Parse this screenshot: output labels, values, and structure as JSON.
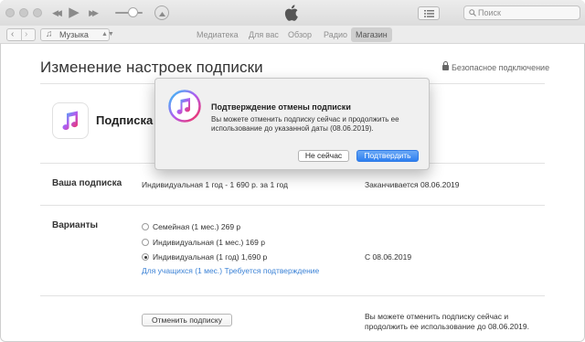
{
  "toolbar": {
    "search_placeholder": "Поиск",
    "rewind_glyph": "◀◀",
    "play_glyph": "▶",
    "forward_glyph": "▶▶"
  },
  "navbar": {
    "back_glyph": "‹",
    "forward_glyph": "›",
    "library_select": "Музыка",
    "library_icon_glyph": "♫",
    "tabs": [
      {
        "label": "Медиатека",
        "active": false
      },
      {
        "label": "Для вас",
        "active": false
      },
      {
        "label": "Обзор",
        "active": false
      },
      {
        "label": "Радио",
        "active": false
      },
      {
        "label": "Магазин",
        "active": true
      }
    ]
  },
  "page": {
    "heading": "Изменение настроек подписки",
    "secure_label": "Безопасное подключение",
    "subscription_title": "Подписка на Apple Music",
    "your_subscription_label": "Ваша подписка",
    "your_subscription_value": "Индивидуальная 1 год - 1 690 р. за 1 год",
    "expires_text": "Заканчивается 08.06.2019",
    "options_label": "Варианты",
    "options": [
      {
        "label": "Семейная (1 мес.) 269 р",
        "selected": false
      },
      {
        "label": "Индивидуальная (1 мес.) 169 р",
        "selected": false
      },
      {
        "label": "Индивидуальная (1 год) 1,690 р",
        "selected": true
      }
    ],
    "option_start": "С 08.06.2019",
    "student_link": "Для учащихся (1 мес.) Требуется подтверждение",
    "cancel_button": "Отменить подписку",
    "cancel_note": "Вы можете отменить подписку сейчас и продолжить ее использование до 08.06.2019."
  },
  "dialog": {
    "title": "Подтверждение отмены подписки",
    "message": "Вы можете отменить подписку сейчас и продолжить ее использование до указанной даты (08.06.2019).",
    "cancel_label": "Не сейчас",
    "confirm_label": "Подтвердить"
  },
  "icons": {
    "music_note": "music-note-icon",
    "apple_logo": "apple-logo-icon",
    "lock": "lock-icon"
  },
  "colors": {
    "accent": "#2e7ff0",
    "link": "#3b82d6"
  }
}
